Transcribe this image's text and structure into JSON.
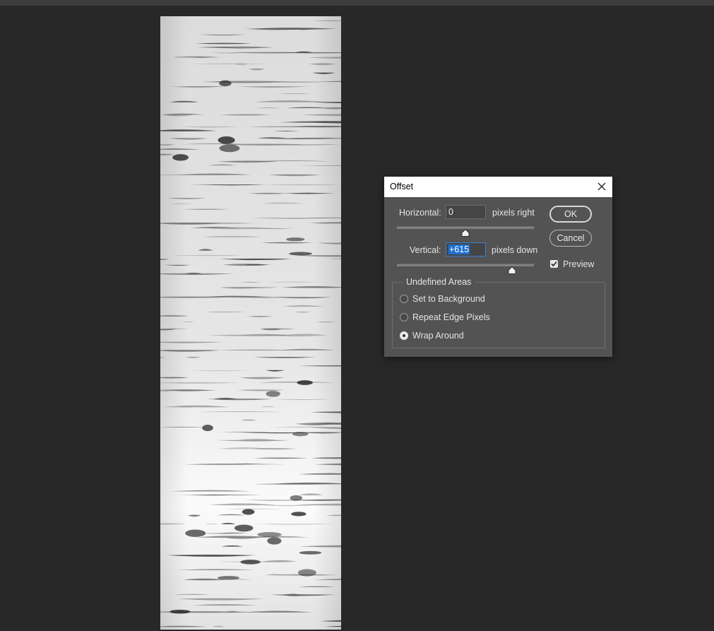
{
  "dialog": {
    "title": "Offset",
    "horizontal": {
      "label": "Horizontal:",
      "value": "0",
      "unit": "pixels right",
      "slider_fraction": 0.5
    },
    "vertical": {
      "label": "Vertical:",
      "value": "+615",
      "unit": "pixels down",
      "slider_fraction": 0.84
    },
    "ok_label": "OK",
    "cancel_label": "Cancel",
    "preview_label": "Preview",
    "preview_checked": true,
    "undefined_areas": {
      "legend": "Undefined Areas",
      "options": [
        {
          "label": "Set to Background",
          "checked": false
        },
        {
          "label": "Repeat Edge Pixels",
          "checked": false
        },
        {
          "label": "Wrap Around",
          "checked": true
        }
      ]
    }
  },
  "canvas": {
    "content": "birch-bark-texture"
  },
  "colors": {
    "workspace_bg": "#282828",
    "dialog_bg": "#535353",
    "selection": "#1e6fd0"
  }
}
